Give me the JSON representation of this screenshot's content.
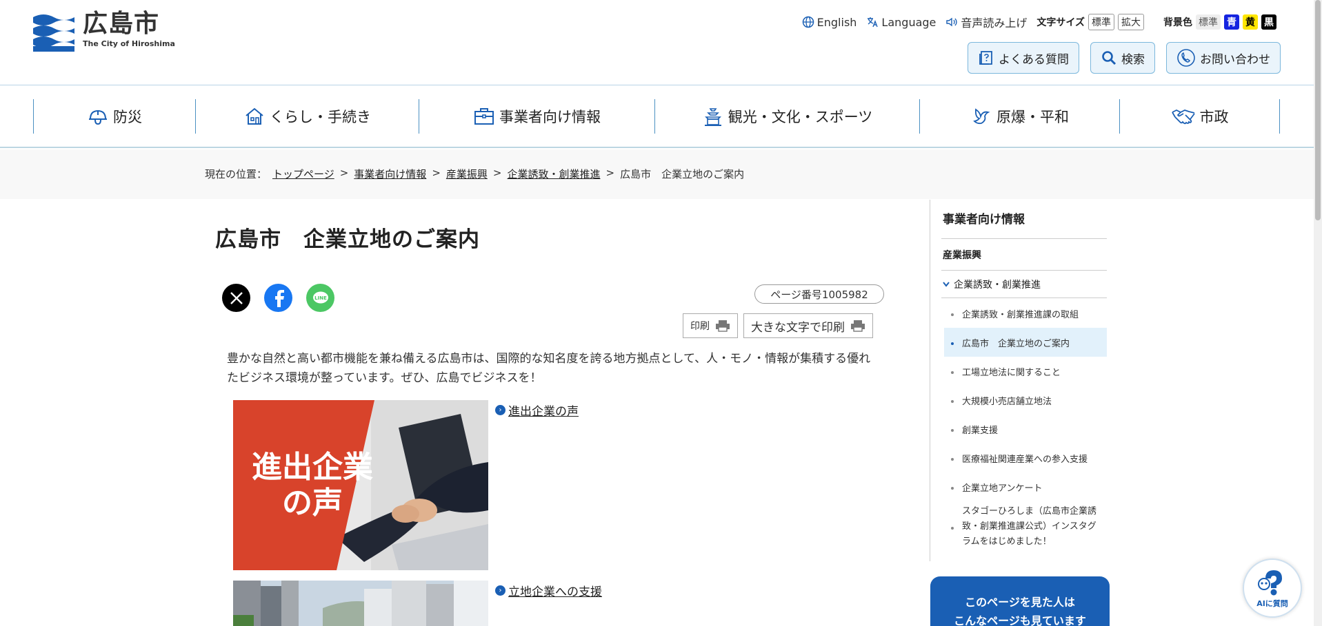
{
  "header": {
    "logo_main": "広島市",
    "logo_sub": "The City of Hiroshima",
    "util": {
      "english": "English",
      "language": "Language",
      "tts": "音声読み上げ",
      "font_size_label": "文字サイズ",
      "font_std": "標準",
      "font_large": "拡大",
      "bg_label": "背景色",
      "bg_std": "標準",
      "bg_blue": "青",
      "bg_yellow": "黄",
      "bg_black": "黒"
    },
    "buttons": {
      "faq": "よくある質問",
      "search": "検索",
      "contact": "お問い合わせ"
    }
  },
  "nav": [
    {
      "label": "防災",
      "icon": "helmet-icon"
    },
    {
      "label": "くらし・手続き",
      "icon": "house-icon"
    },
    {
      "label": "事業者向け情報",
      "icon": "briefcase-icon"
    },
    {
      "label": "観光・文化・スポーツ",
      "icon": "castle-icon"
    },
    {
      "label": "原爆・平和",
      "icon": "dove-icon"
    },
    {
      "label": "市政",
      "icon": "handshake-icon"
    }
  ],
  "breadcrumb": {
    "prefix": "現在の位置：",
    "items": [
      "トップページ",
      "事業者向け情報",
      "産業振興",
      "企業誘致・創業推進"
    ],
    "current": "広島市　企業立地のご案内",
    "sep": ">"
  },
  "main": {
    "title": "広島市　企業立地のご案内",
    "page_number": "ページ番号1005982",
    "print": "印刷",
    "print_large": "大きな文字で印刷",
    "intro": "豊かな自然と高い都市機能を兼ね備える広島市は、国際的な知名度を誇る地方拠点として、人・モノ・情報が集積する優れたビジネス環境が整っています。ぜひ、広島でビジネスを！",
    "cards": [
      {
        "image_text_1": "進出企業",
        "image_text_2": "の声",
        "link": "進出企業の声"
      },
      {
        "link": "立地企業への支援"
      }
    ]
  },
  "sidebar": {
    "heading": "事業者向け情報",
    "category": "産業振興",
    "sub": "企業誘致・創業推進",
    "items": [
      {
        "label": "企業誘致・創業推進課の取組",
        "active": false
      },
      {
        "label": "広島市　企業立地のご案内",
        "active": true
      },
      {
        "label": "工場立地法に関すること",
        "active": false
      },
      {
        "label": "大規模小売店舗立地法",
        "active": false
      },
      {
        "label": "創業支援",
        "active": false
      },
      {
        "label": "医療福祉関連産業への参入支援",
        "active": false
      },
      {
        "label": "企業立地アンケート",
        "active": false
      },
      {
        "label": "スタゴーひろしま（広島市企業誘致・創業推進課公式）インスタグラムをはじめました！",
        "active": false
      }
    ],
    "recommend_line1": "このページを見た人は",
    "recommend_line2": "こんなページも見ています"
  },
  "ai_button": {
    "label": "AIに質問"
  },
  "colors": {
    "brand": "#1a5fb4",
    "nav_border": "#4a90c2",
    "button_bg": "#eaf4fb",
    "hero_red": "#d8432b"
  }
}
